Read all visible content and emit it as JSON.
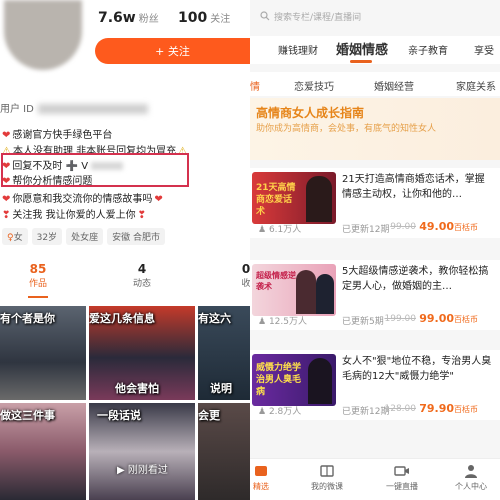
{
  "profile": {
    "followers": "7.6w",
    "followers_label": "粉丝",
    "following": "100",
    "following_label": "关注",
    "follow_button": "+ 关注",
    "uid_label": "用户 ID",
    "bio_lines": [
      "感谢官方快手绿色平台",
      "本人没有助理 非本账号回复均为冒充",
      "回复不及时 ➕ V",
      "帮你分析情感问题",
      "你愿意和我交流你的情感故事吗",
      "关注我 我让你爱的人爱上你"
    ],
    "tags": [
      "女",
      "32岁",
      "处女座",
      "安徽 合肥市"
    ],
    "tabs": [
      {
        "count": "85",
        "label": "作品"
      },
      {
        "count": "4",
        "label": "动态"
      },
      {
        "count": "0",
        "label": "收"
      }
    ],
    "videos": [
      {
        "top": "有个者是你",
        "bottom": ""
      },
      {
        "top": "爱这几条信息",
        "bottom": "他会害怕"
      },
      {
        "top": "有这六",
        "bottom": "说明"
      },
      {
        "top": "",
        "bottom": "做这三件事"
      },
      {
        "top": "一段话说",
        "bottom": "刚刚看过"
      },
      {
        "top": "",
        "bottom": "会更"
      }
    ]
  },
  "store": {
    "search_placeholder": "搜索专栏/课程/直播间",
    "categories": [
      "赚钱理财",
      "婚姻情感",
      "亲子教育",
      "享受"
    ],
    "subtabs": [
      "情",
      "恋爱技巧",
      "婚姻经营",
      "家庭关系"
    ],
    "banner": {
      "title": "高情商女人成长指南",
      "subtitle": "助你成为高情商，会处事，有底气的知性女人"
    },
    "courses": [
      {
        "title": "21天打造高情商婚恋话术，掌握情感主动权，让你和他的…",
        "thumb_text": "21天高情商恋爱话术",
        "learners": "6.1万人",
        "updates": "已更新12期",
        "old_price": "99.00",
        "price": "49.00",
        "unit": "百栝币"
      },
      {
        "title": "5大超级情感逆袭术，教你轻松搞定男人心，做婚姻的主…",
        "thumb_text": "超级情感逆袭术",
        "learners": "12.5万人",
        "updates": "已更新5期",
        "old_price": "199.00",
        "price": "99.00",
        "unit": "百栝币"
      },
      {
        "title": "女人不\"狠\"地位不稳，专治男人臭毛病的12大\"威慑力绝学\"",
        "thumb_text": "威慑力绝学 治男人臭毛病",
        "learners": "2.8万人",
        "updates": "已更新12期",
        "old_price": "128.00",
        "price": "79.90",
        "unit": "百栝币"
      }
    ],
    "nav": [
      "精选",
      "我的微课",
      "一键直播",
      "个人中心"
    ]
  },
  "colors": {
    "accent": "#e9621e",
    "follow": "#fe5a1d",
    "highlight_border": "#d4314e"
  }
}
